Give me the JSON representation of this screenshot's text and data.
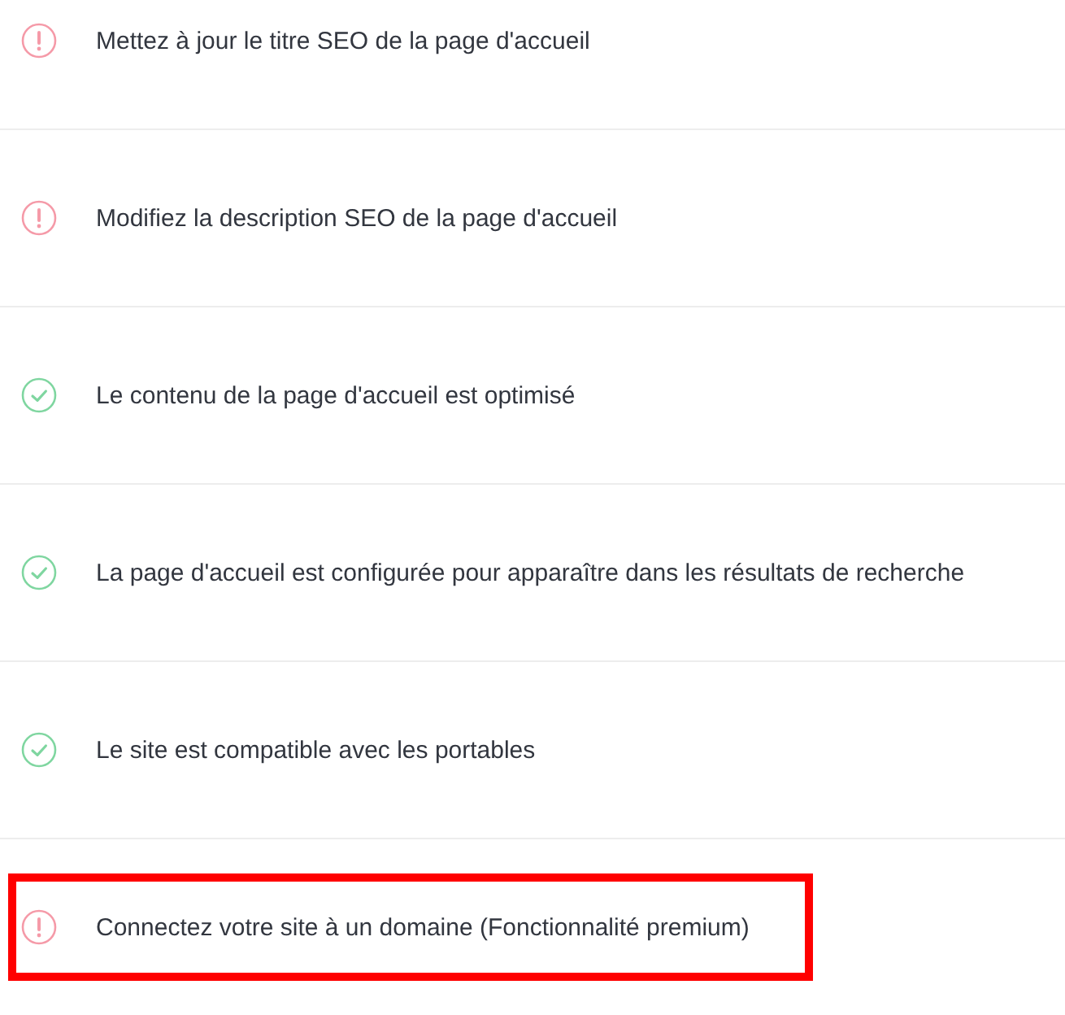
{
  "checklist": [
    {
      "kind": "warning",
      "text": "Mettez à jour le titre SEO de la page d'accueil",
      "highlighted": false
    },
    {
      "kind": "warning",
      "text": "Modifiez la description SEO de la page d'accueil",
      "highlighted": false
    },
    {
      "kind": "ok",
      "text": "Le contenu de la page d'accueil est optimisé",
      "highlighted": false
    },
    {
      "kind": "ok",
      "text": "La page d'accueil est configurée pour apparaître dans les résultats de recherche",
      "highlighted": false
    },
    {
      "kind": "ok",
      "text": "Le site est compatible avec les portables",
      "highlighted": false
    },
    {
      "kind": "warning",
      "text": "Connectez votre site à un domaine (Fonctionnalité premium)",
      "highlighted": true
    }
  ]
}
